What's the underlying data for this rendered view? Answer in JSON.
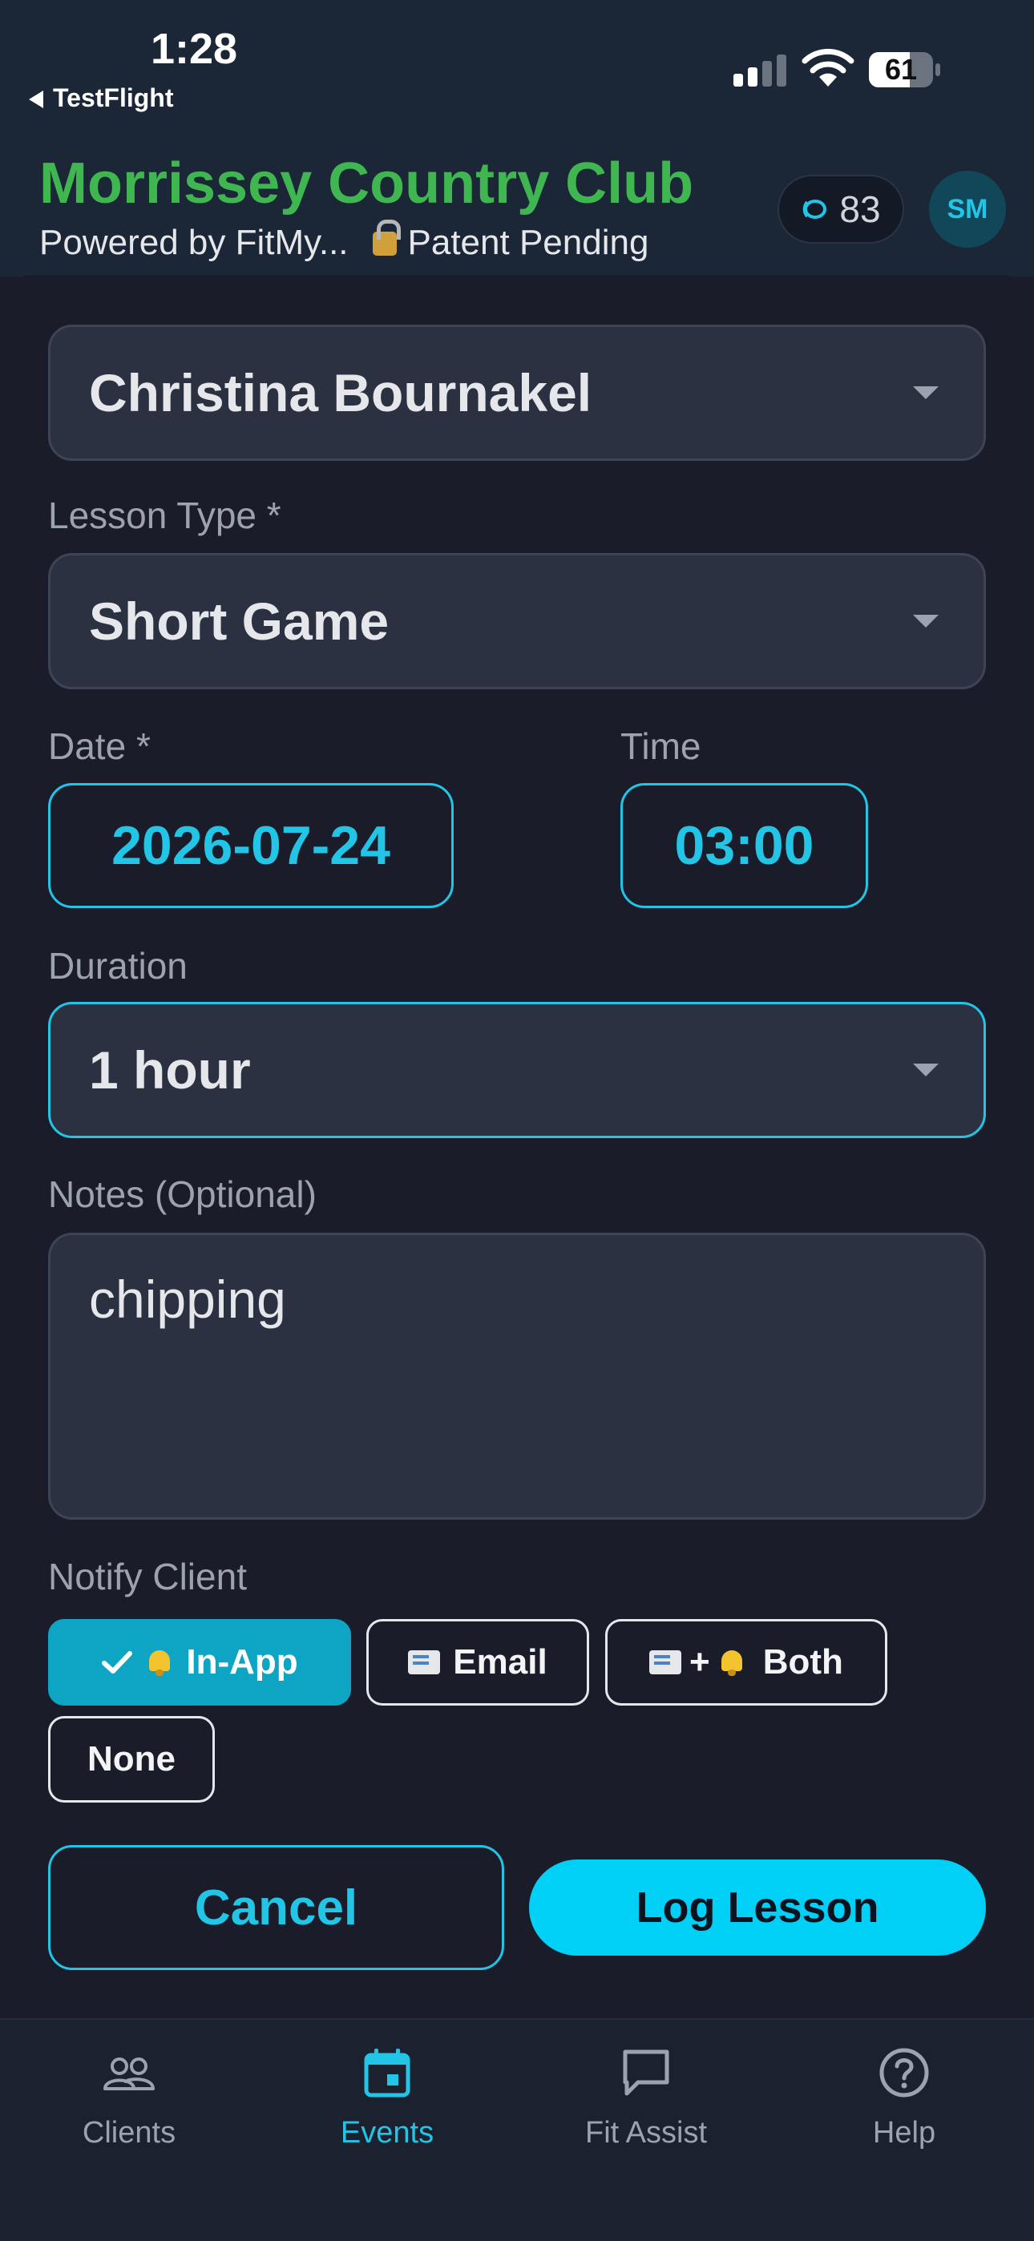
{
  "status_bar": {
    "time": "1:28",
    "back_label": "TestFlight",
    "battery": "61"
  },
  "header": {
    "title": "Morrissey Country Club",
    "subtitle": "Powered by FitMy...",
    "patent": "Patent Pending",
    "score": "83",
    "avatar_initials": "SM",
    "colors": {
      "title": "#3fb64f",
      "accent": "#22c5e6"
    }
  },
  "form": {
    "client": {
      "value": "Christina Bournakel"
    },
    "lesson_type": {
      "label": "Lesson Type *",
      "value": "Short Game"
    },
    "date": {
      "label": "Date *",
      "value": "2026-07-24"
    },
    "time": {
      "label": "Time",
      "value": "03:00"
    },
    "duration": {
      "label": "Duration",
      "value": "1 hour"
    },
    "notes": {
      "label": "Notes (Optional)",
      "value": "chipping"
    },
    "notify": {
      "label": "Notify Client",
      "options": [
        {
          "label": "In-App",
          "selected": true,
          "icons": [
            "check-icon",
            "bell-icon"
          ]
        },
        {
          "label": "Email",
          "selected": false,
          "icons": [
            "envelope-icon"
          ]
        },
        {
          "label": "Both",
          "prefix": "+",
          "selected": false,
          "icons": [
            "envelope-icon",
            "bell-icon"
          ]
        },
        {
          "label": "None",
          "selected": false,
          "icons": []
        }
      ]
    },
    "cancel_label": "Cancel",
    "submit_label": "Log Lesson"
  },
  "tabbar": {
    "tabs": [
      {
        "label": "Clients",
        "icon": "people-icon",
        "active": false
      },
      {
        "label": "Events",
        "icon": "calendar-icon",
        "active": true
      },
      {
        "label": "Fit Assist",
        "icon": "chat-bubble-icon",
        "active": false
      },
      {
        "label": "Help",
        "icon": "help-circle-icon",
        "active": false
      }
    ]
  }
}
